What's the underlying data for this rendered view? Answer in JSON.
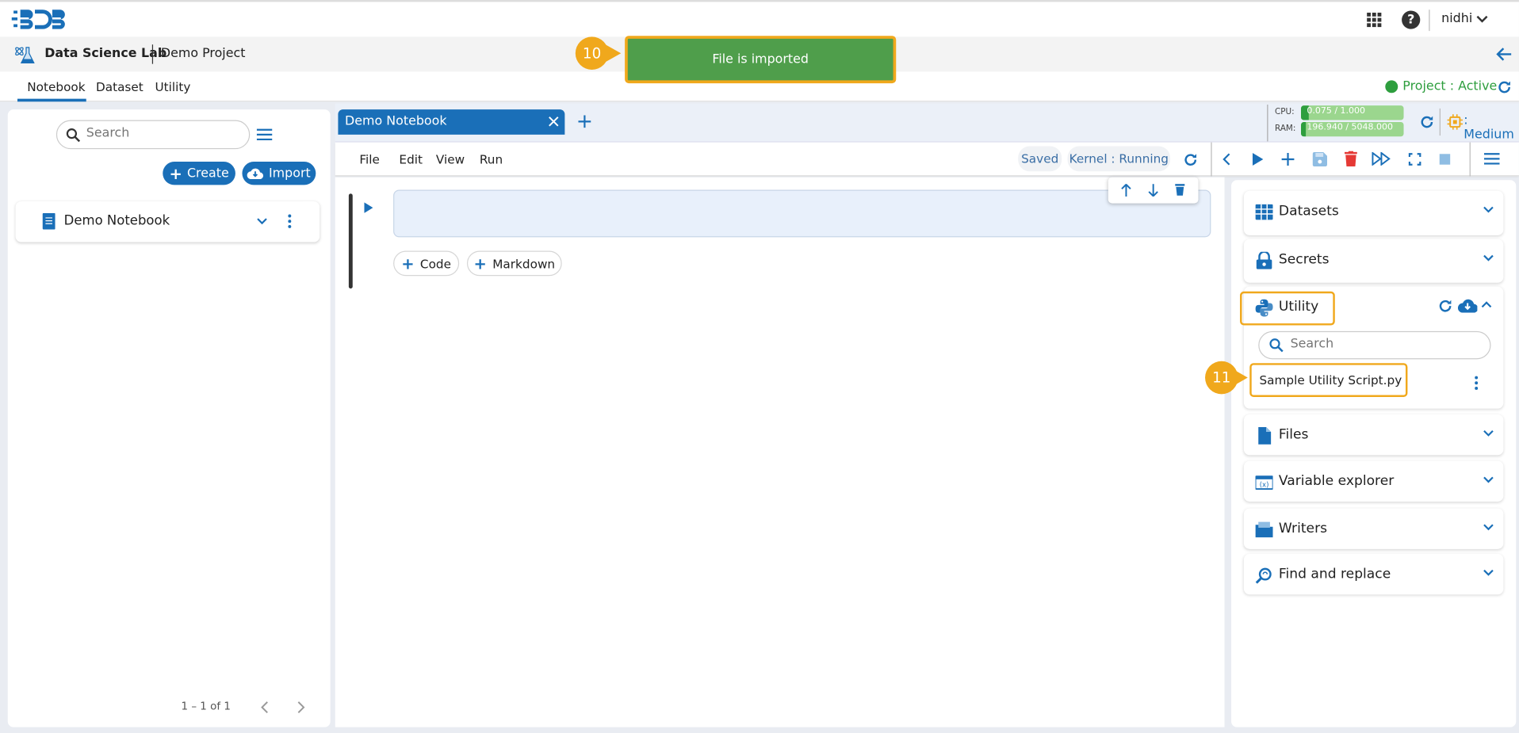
{
  "header": {
    "user": "nidhi",
    "logo_text": "BDB"
  },
  "subheader": {
    "app": "Data Science Lab",
    "project": "Demo Project"
  },
  "tabs": [
    {
      "label": "Notebook",
      "active": true
    },
    {
      "label": "Dataset"
    },
    {
      "label": "Utility"
    }
  ],
  "project_status": "Project : Active",
  "toast": {
    "message": "File is imported",
    "step": "10"
  },
  "left": {
    "search_placeholder": "Search",
    "create": "Create",
    "import": "Import",
    "notebooks": [
      {
        "name": "Demo Notebook"
      }
    ],
    "pagination": "1 – 1 of 1"
  },
  "notebook_tab": "Demo Notebook",
  "resources": {
    "cpu_label": "CPU:",
    "cpu_value": "0.075 / 1.000",
    "cpu_fraction": 0.075,
    "ram_label": "RAM:",
    "ram_value": "196.940 / 5048.000",
    "ram_fraction": 0.039,
    "size": ": Medium"
  },
  "menu": [
    "File",
    "Edit",
    "View",
    "Run"
  ],
  "status": {
    "saved": "Saved",
    "kernel": "Kernel : Running"
  },
  "cell": {
    "add_code": "Code",
    "add_markdown": "Markdown"
  },
  "right": {
    "sections": [
      {
        "label": "Datasets",
        "icon": "dataset-icon"
      },
      {
        "label": "Secrets",
        "icon": "lock-icon"
      },
      {
        "label": "Utility",
        "icon": "python-icon",
        "expanded": true
      },
      {
        "label": "Files",
        "icon": "file-icon"
      },
      {
        "label": "Variable explorer",
        "icon": "variable-icon"
      },
      {
        "label": "Writers",
        "icon": "folder-icon"
      },
      {
        "label": "Find and replace",
        "icon": "find-icon"
      }
    ],
    "utility_search_placeholder": "Search",
    "utility_items": [
      "Sample Utility Script.py"
    ],
    "step": "11"
  },
  "colors": {
    "primary": "#1a6fb8",
    "toast": "#4f9e4b",
    "highlight": "#f0a81c",
    "active": "#2e9e3e",
    "delete": "#e53935"
  }
}
